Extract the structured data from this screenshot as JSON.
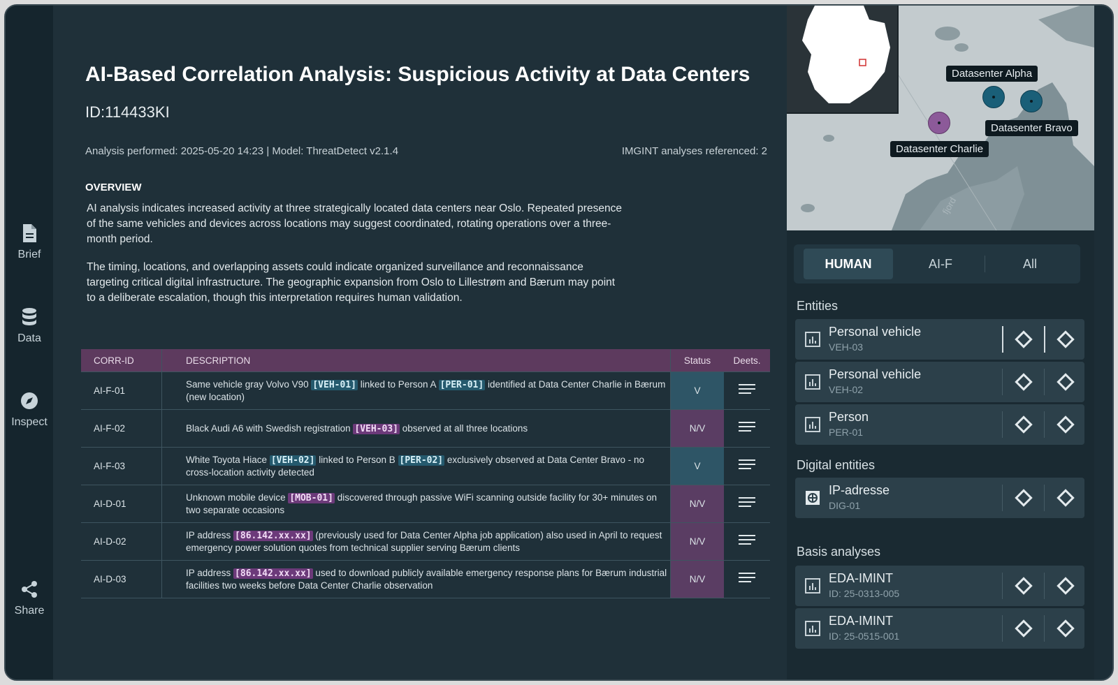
{
  "rail": {
    "items": [
      {
        "label": "Brief"
      },
      {
        "label": "Data"
      },
      {
        "label": "Inspect"
      },
      {
        "label": "Share"
      }
    ]
  },
  "report": {
    "title": "AI-Based Correlation Analysis: Suspicious Activity at Data Centers",
    "id": "ID:114433KI",
    "meta_left": "Analysis performed: 2025-05-20 14:23 | Model: ThreatDetect v2.1.4",
    "meta_right": "IMGINT analyses referenced: 2",
    "overview_heading": "OVERVIEW",
    "overview_p1": "AI analysis indicates increased activity at three strategically located data centers near Oslo. Repeated presence of the same vehicles and devices across locations may suggest coordinated, rotating operations over a three-month period.",
    "overview_p2": "The timing, locations, and overlapping assets could indicate organized surveillance and reconnaissance targeting critical digital infrastructure. The geographic expansion from Oslo to Lillestrøm and Bærum may point to a deliberate escalation, though this interpretation requires human validation."
  },
  "table": {
    "headers": {
      "id": "CORR-ID",
      "desc": "DESCRIPTION",
      "status": "Status",
      "deets": "Deets."
    },
    "rows": [
      {
        "id": "AI-F-01",
        "parts": [
          {
            "t": "Same vehicle gray Volvo V90 "
          },
          {
            "t": "[VEH-01]",
            "tag": "blue"
          },
          {
            "t": " linked to Person A "
          },
          {
            "t": "[PER-01]",
            "tag": "blue"
          },
          {
            "t": " identified at Data Center Charlie in Bærum (new location)"
          }
        ],
        "status": "V",
        "status_kind": "v"
      },
      {
        "id": "AI-F-02",
        "parts": [
          {
            "t": "Black Audi A6 with Swedish registration "
          },
          {
            "t": "[VEH-03]",
            "tag": "purple"
          },
          {
            "t": " observed at all three locations"
          }
        ],
        "status": "N/V",
        "status_kind": "nv"
      },
      {
        "id": "AI-F-03",
        "parts": [
          {
            "t": "White Toyota Hiace "
          },
          {
            "t": "[VEH-02]",
            "tag": "blue"
          },
          {
            "t": " linked to Person B "
          },
          {
            "t": "[PER-02]",
            "tag": "blue"
          },
          {
            "t": " exclusively observed at Data Center Bravo - no cross-location activity detected"
          }
        ],
        "status": "V",
        "status_kind": "v"
      },
      {
        "id": "AI-D-01",
        "parts": [
          {
            "t": "Unknown mobile device "
          },
          {
            "t": "[MOB-01]",
            "tag": "purple"
          },
          {
            "t": " discovered through passive WiFi scanning outside facility for 30+ minutes on two separate occasions"
          }
        ],
        "status": "N/V",
        "status_kind": "nv"
      },
      {
        "id": "AI-D-02",
        "parts": [
          {
            "t": "IP address "
          },
          {
            "t": "[86.142.xx.xx]",
            "tag": "purple"
          },
          {
            "t": " (previously used for Data Center Alpha job application) also used in April to request emergency power solution quotes from technical supplier serving Bærum clients"
          }
        ],
        "status": "N/V",
        "status_kind": "nv"
      },
      {
        "id": "AI-D-03",
        "parts": [
          {
            "t": "IP address "
          },
          {
            "t": "[86.142.xx.xx]",
            "tag": "purple"
          },
          {
            "t": " used to download publicly available emergency response plans for Bærum industrial facilities two weeks before Data Center Charlie observation"
          }
        ],
        "status": "N/V",
        "status_kind": "nv"
      }
    ]
  },
  "map": {
    "labels": {
      "alpha": "Datasenter Alpha",
      "bravo": "Datasenter Bravo",
      "charlie": "Datasenter Charlie"
    },
    "water_label": "fjord"
  },
  "filter_tabs": [
    "HUMAN",
    "AI-F",
    "All"
  ],
  "sections": {
    "entities": "Entities",
    "digital": "Digital entities",
    "basis": "Basis analyses"
  },
  "entities": [
    {
      "name": "Personal vehicle",
      "sub": "VEH-03"
    },
    {
      "name": "Personal vehicle",
      "sub": "VEH-02"
    },
    {
      "name": "Person",
      "sub": "PER-01"
    }
  ],
  "digital_entities": [
    {
      "name": "IP-adresse",
      "sub": "DIG-01"
    }
  ],
  "basis_analyses": [
    {
      "name": "EDA-IMINT",
      "sub": "ID: 25-0313-005"
    },
    {
      "name": "EDA-IMINT",
      "sub": "ID: 25-0515-001"
    }
  ],
  "colors": {
    "accent_blue": "#255a6e",
    "accent_purple": "#6c3a7a",
    "header_purple": "#5d3a5e"
  }
}
